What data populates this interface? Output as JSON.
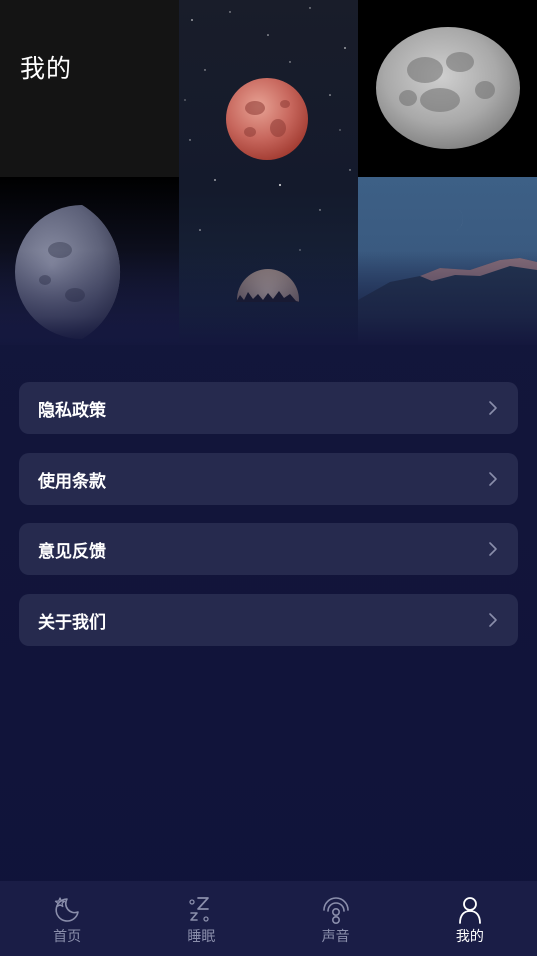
{
  "header": {
    "title": "我的"
  },
  "menu": {
    "items": [
      {
        "label": "隐私政策"
      },
      {
        "label": "使用条款"
      },
      {
        "label": "意见反馈"
      },
      {
        "label": "关于我们"
      }
    ]
  },
  "tabbar": {
    "items": [
      {
        "label": "首页",
        "icon": "moon-star-icon",
        "active": false
      },
      {
        "label": "睡眠",
        "icon": "sleep-zz-icon",
        "active": false
      },
      {
        "label": "声音",
        "icon": "sound-signal-icon",
        "active": false
      },
      {
        "label": "我的",
        "icon": "person-icon",
        "active": true
      }
    ]
  },
  "colors": {
    "background": "#13163b",
    "card": "#262a4e",
    "tabbar": "#1a1d46",
    "tab_inactive": "#8a8eab",
    "tab_active": "#ffffff"
  }
}
